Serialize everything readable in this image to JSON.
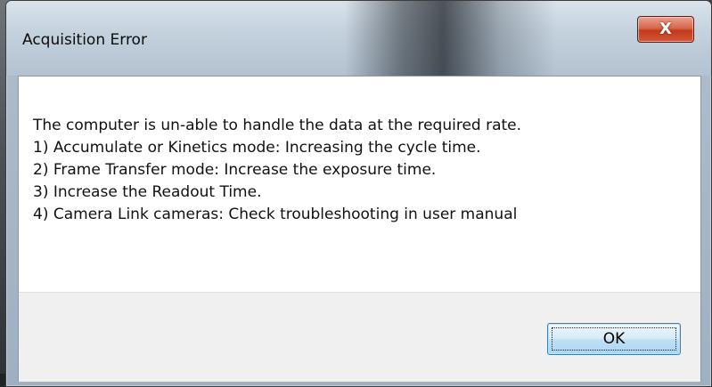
{
  "dialog": {
    "title": "Acquisition Error",
    "close_glyph": "X",
    "message_lines": [
      "The computer is un-able to handle the data at the required rate.",
      "1) Accumulate or Kinetics mode: Increasing the cycle time.",
      "2) Frame Transfer mode: Increase the exposure time.",
      "3) Increase the Readout Time.",
      "4) Camera Link cameras: Check troubleshooting in user manual"
    ],
    "ok_label": "OK"
  },
  "icons": {
    "close": "close-icon"
  },
  "colors": {
    "close_button": "#c23a1c",
    "ok_border": "#3c7fb1",
    "message_bg": "#ffffff",
    "button_bar_bg": "#f0f0f0"
  }
}
